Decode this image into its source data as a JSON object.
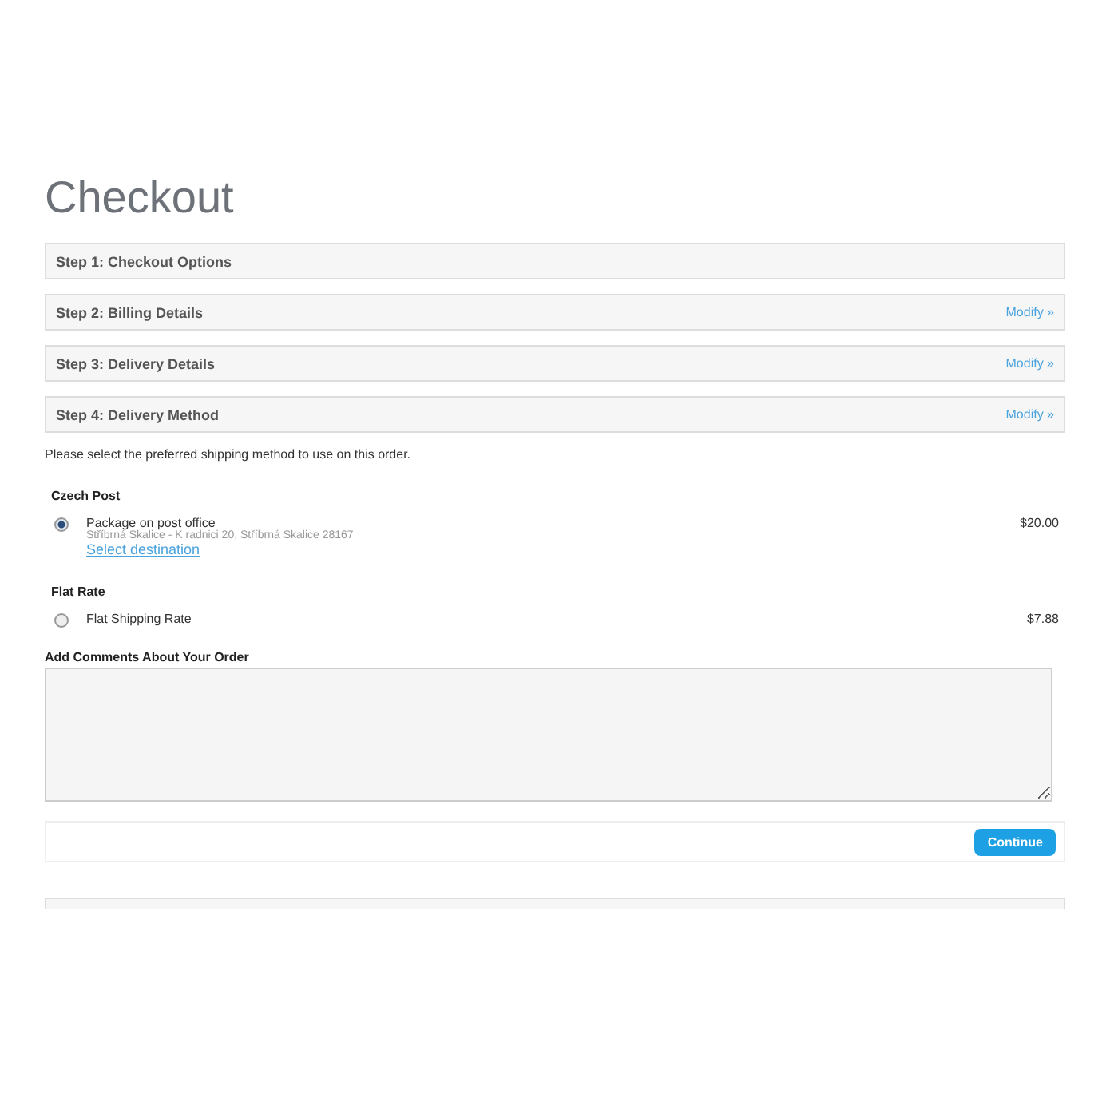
{
  "title": "Checkout",
  "steps": [
    {
      "label": "Step 1: Checkout Options"
    },
    {
      "label": "Step 2: Billing Details",
      "link": "Modify »"
    },
    {
      "label": "Step 3: Delivery Details",
      "link": "Modify »"
    },
    {
      "label": "Step 4: Delivery Method",
      "link": "Modify »"
    }
  ],
  "instruction": "Please select the preferred shipping method to use on this order.",
  "shipping_groups": [
    {
      "name": "Czech Post",
      "options": [
        {
          "label": "Package on post office",
          "address": "Stříbrná Skalice - K radnici 20, Stříbrná Skalice 28167",
          "link": "Select destination",
          "price": "$20.00",
          "selected": true
        }
      ]
    },
    {
      "name": "Flat Rate",
      "options": [
        {
          "label": "Flat Shipping Rate",
          "price": "$7.88",
          "selected": false
        }
      ]
    }
  ],
  "comments": {
    "label": "Add Comments About Your Order"
  },
  "continue_button": "Continue"
}
